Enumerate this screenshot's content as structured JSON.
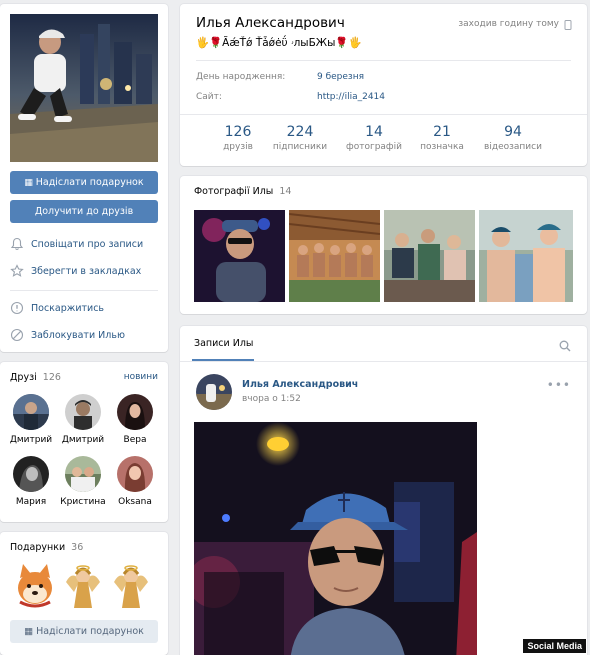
{
  "profile": {
    "name": "Илья Александрович",
    "status": "🖐🌹ÃǽŤǿ Ťǡǿėΰ ۥлыБЖы🌹🖐",
    "last_seen": "заходив годину тому",
    "birthday_label": "День народження:",
    "birthday_value": "9 березня",
    "site_label": "Сайт:",
    "site_value": "http://ilia_2414"
  },
  "counters": [
    {
      "value": "126",
      "label": "друзів"
    },
    {
      "value": "224",
      "label": "підписники"
    },
    {
      "value": "14",
      "label": "фотографій"
    },
    {
      "value": "21",
      "label": "позначка"
    },
    {
      "value": "94",
      "label": "відеозаписи"
    }
  ],
  "actions": {
    "send_gift": "Надіслати подарунок",
    "add_friend": "Долучити до друзів",
    "notify": "Сповіщати про записи",
    "bookmark": "Зберегти в закладках",
    "report": "Поскаржитись",
    "block": "Заблокувати Илью"
  },
  "friends": {
    "title": "Друзі",
    "count": "126",
    "link": "новини",
    "items": [
      {
        "name": "Дмитрий",
        "color": "#4a5d78"
      },
      {
        "name": "Дмитрий",
        "color": "#3b3b3b"
      },
      {
        "name": "Вера",
        "color": "#5a3a3a"
      },
      {
        "name": "Мария",
        "color": "#2e2e2e"
      },
      {
        "name": "Кристина",
        "color": "#7a8b6a"
      },
      {
        "name": "Oksana",
        "color": "#a0645a"
      }
    ]
  },
  "gifts": {
    "title": "Подарунки",
    "count": "36",
    "send": "Надіслати подарунок"
  },
  "photos": {
    "title": "Фотографії Илы",
    "count": "14"
  },
  "wall": {
    "tab": "Записи Илы",
    "post_author": "Илья Александрович",
    "post_time": "вчора о 1:52"
  },
  "watermark": "Social Media",
  "colors": {
    "accent": "#5181b8",
    "link": "#2a5885",
    "background": "#edeef0"
  }
}
